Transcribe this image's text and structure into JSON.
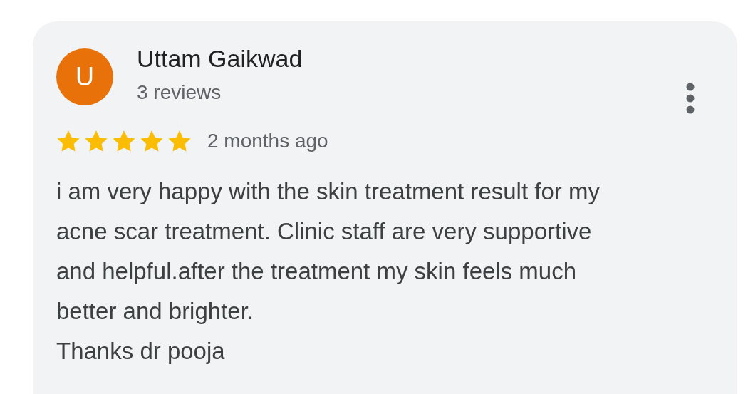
{
  "review": {
    "avatar_letter": "U",
    "author": "Uttam Gaikwad",
    "review_count": "3 reviews",
    "stars": 5,
    "time": "2 months ago",
    "text": "i am very happy with the skin treatment result for my\nacne scar treatment. Clinic staff are very supportive\nand helpful.after the treatment my skin feels much\nbetter and brighter.\nThanks dr pooja"
  }
}
